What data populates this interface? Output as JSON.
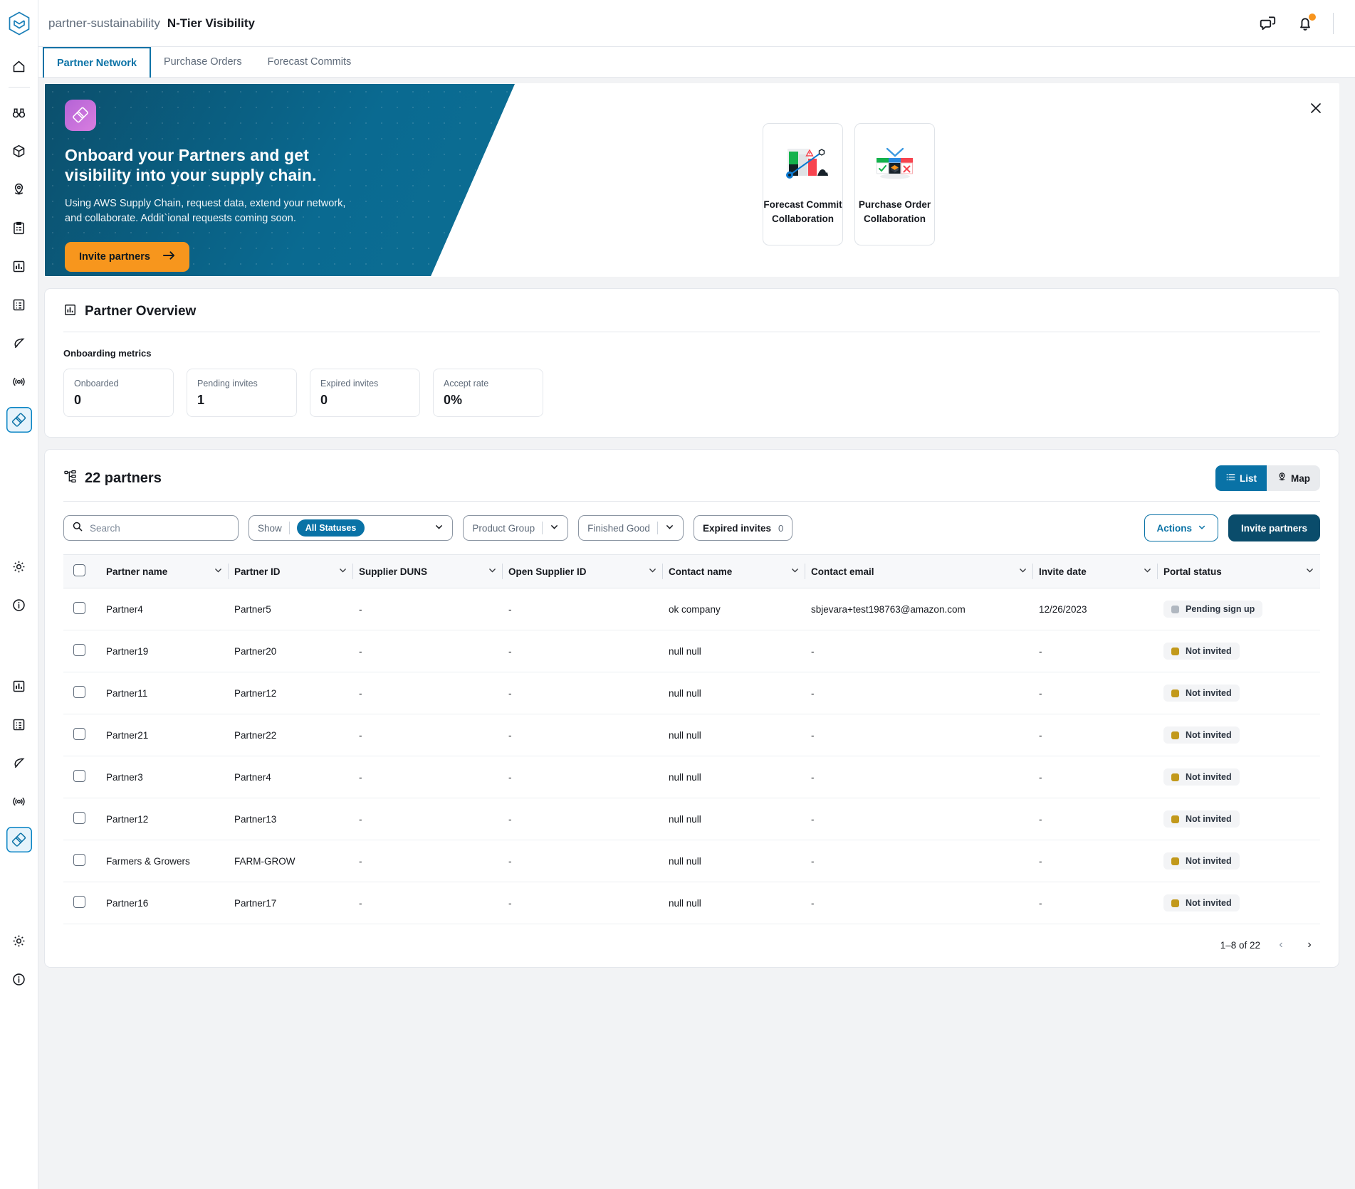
{
  "app": {
    "brand_sub": "partner-sustainability",
    "brand_main": "N-Tier Visibility"
  },
  "topbar": {
    "chat_icon": "chat-icon",
    "bell_icon": "bell-icon"
  },
  "tabs": [
    {
      "label": "Partner Network",
      "active": true
    },
    {
      "label": "Purchase Orders",
      "active": false
    },
    {
      "label": "Forecast Commits",
      "active": false
    }
  ],
  "sidebar": {
    "logo": "aws-supply-chain-logo",
    "items": [
      {
        "name": "home-icon"
      },
      {
        "name": "insights-binoculars-icon"
      },
      {
        "name": "inventory-box-icon"
      },
      {
        "name": "location-pin-icon"
      },
      {
        "name": "clipboard-icon"
      },
      {
        "name": "analytics-bar-chart-icon"
      },
      {
        "name": "list-detail-icon"
      },
      {
        "name": "sustainability-leaf-icon"
      },
      {
        "name": "network-radar-icon"
      },
      {
        "name": "n-tier-visibility-icon"
      }
    ],
    "bottom_items": [
      {
        "name": "settings-gear-icon"
      },
      {
        "name": "info-circle-icon"
      }
    ]
  },
  "hero": {
    "title": "Onboard your Partners and get visibility into your supply chain.",
    "description": "Using AWS Supply Chain, request data, extend your network, and collaborate. Addit`ional requests coming soon.",
    "cta_label": "Invite partners",
    "close_icon": "close-icon",
    "badge_icon": "n-tier-diamond-icon",
    "cards": [
      {
        "label": "Forecast Commit Collaboration",
        "icon": "forecast-commit-chart-illustration"
      },
      {
        "label": "Purchase Order Collaboration",
        "icon": "purchase-order-grid-illustration"
      }
    ]
  },
  "overview": {
    "title": "Partner Overview",
    "icon": "bar-chart-icon",
    "metrics_label": "Onboarding metrics",
    "metrics": [
      {
        "label": "Onboarded",
        "value": "0"
      },
      {
        "label": "Pending invites",
        "value": "1"
      },
      {
        "label": "Expired invites",
        "value": "0"
      },
      {
        "label": "Accept rate",
        "value": "0%"
      }
    ]
  },
  "partners": {
    "title": "22 partners",
    "title_icon": "org-tree-icon",
    "view_toggle": [
      {
        "label": "List",
        "icon": "list-icon",
        "active": true
      },
      {
        "label": "Map",
        "icon": "map-pin-icon",
        "active": false
      }
    ],
    "search_placeholder": "Search",
    "search_value": "",
    "filters": {
      "show_label": "Show",
      "status_value": "All Statuses",
      "product_group_label": "Product Group",
      "finished_good_label": "Finished Good",
      "expired_invites_label": "Expired invites",
      "expired_invites_count": "0"
    },
    "actions_label": "Actions",
    "invite_label": "Invite partners",
    "columns": [
      "Partner name",
      "Partner ID",
      "Supplier DUNS",
      "Open Supplier ID",
      "Contact name",
      "Contact email",
      "Invite date",
      "Portal status"
    ],
    "rows": [
      {
        "partner_name": "Partner4",
        "partner_id": "Partner5",
        "supplier_duns": "-",
        "open_supplier_id": "-",
        "contact_name": "ok company",
        "contact_email": "sbjevara+test198763@amazon.com",
        "invite_date": "12/26/2023",
        "portal_status": "Pending sign up",
        "status_color": "#b0b7c0"
      },
      {
        "partner_name": "Partner19",
        "partner_id": "Partner20",
        "supplier_duns": "-",
        "open_supplier_id": "-",
        "contact_name": "null null",
        "contact_email": "-",
        "invite_date": "-",
        "portal_status": "Not invited",
        "status_color": "#c2991b"
      },
      {
        "partner_name": "Partner11",
        "partner_id": "Partner12",
        "supplier_duns": "-",
        "open_supplier_id": "-",
        "contact_name": "null null",
        "contact_email": "-",
        "invite_date": "-",
        "portal_status": "Not invited",
        "status_color": "#c2991b"
      },
      {
        "partner_name": "Partner21",
        "partner_id": "Partner22",
        "supplier_duns": "-",
        "open_supplier_id": "-",
        "contact_name": "null null",
        "contact_email": "-",
        "invite_date": "-",
        "portal_status": "Not invited",
        "status_color": "#c2991b"
      },
      {
        "partner_name": "Partner3",
        "partner_id": "Partner4",
        "supplier_duns": "-",
        "open_supplier_id": "-",
        "contact_name": "null null",
        "contact_email": "-",
        "invite_date": "-",
        "portal_status": "Not invited",
        "status_color": "#c2991b"
      },
      {
        "partner_name": "Partner12",
        "partner_id": "Partner13",
        "supplier_duns": "-",
        "open_supplier_id": "-",
        "contact_name": "null null",
        "contact_email": "-",
        "invite_date": "-",
        "portal_status": "Not invited",
        "status_color": "#c2991b"
      },
      {
        "partner_name": "Farmers & Growers",
        "partner_id": "FARM-GROW",
        "supplier_duns": "-",
        "open_supplier_id": "-",
        "contact_name": "null null",
        "contact_email": "-",
        "invite_date": "-",
        "portal_status": "Not invited",
        "status_color": "#c2991b"
      },
      {
        "partner_name": "Partner16",
        "partner_id": "Partner17",
        "supplier_duns": "-",
        "open_supplier_id": "-",
        "contact_name": "null null",
        "contact_email": "-",
        "invite_date": "-",
        "portal_status": "Not invited",
        "status_color": "#c2991b"
      }
    ],
    "pagination": {
      "range": "1–8 of 22",
      "prev_icon": "chevron-left-icon",
      "next_icon": "chevron-right-icon"
    }
  },
  "colors": {
    "accent_blue": "#0972a6",
    "dark_blue": "#0a4c6b",
    "orange": "#f7961d",
    "status_pending": "#b0b7c0",
    "status_not_invited": "#c2991b"
  }
}
